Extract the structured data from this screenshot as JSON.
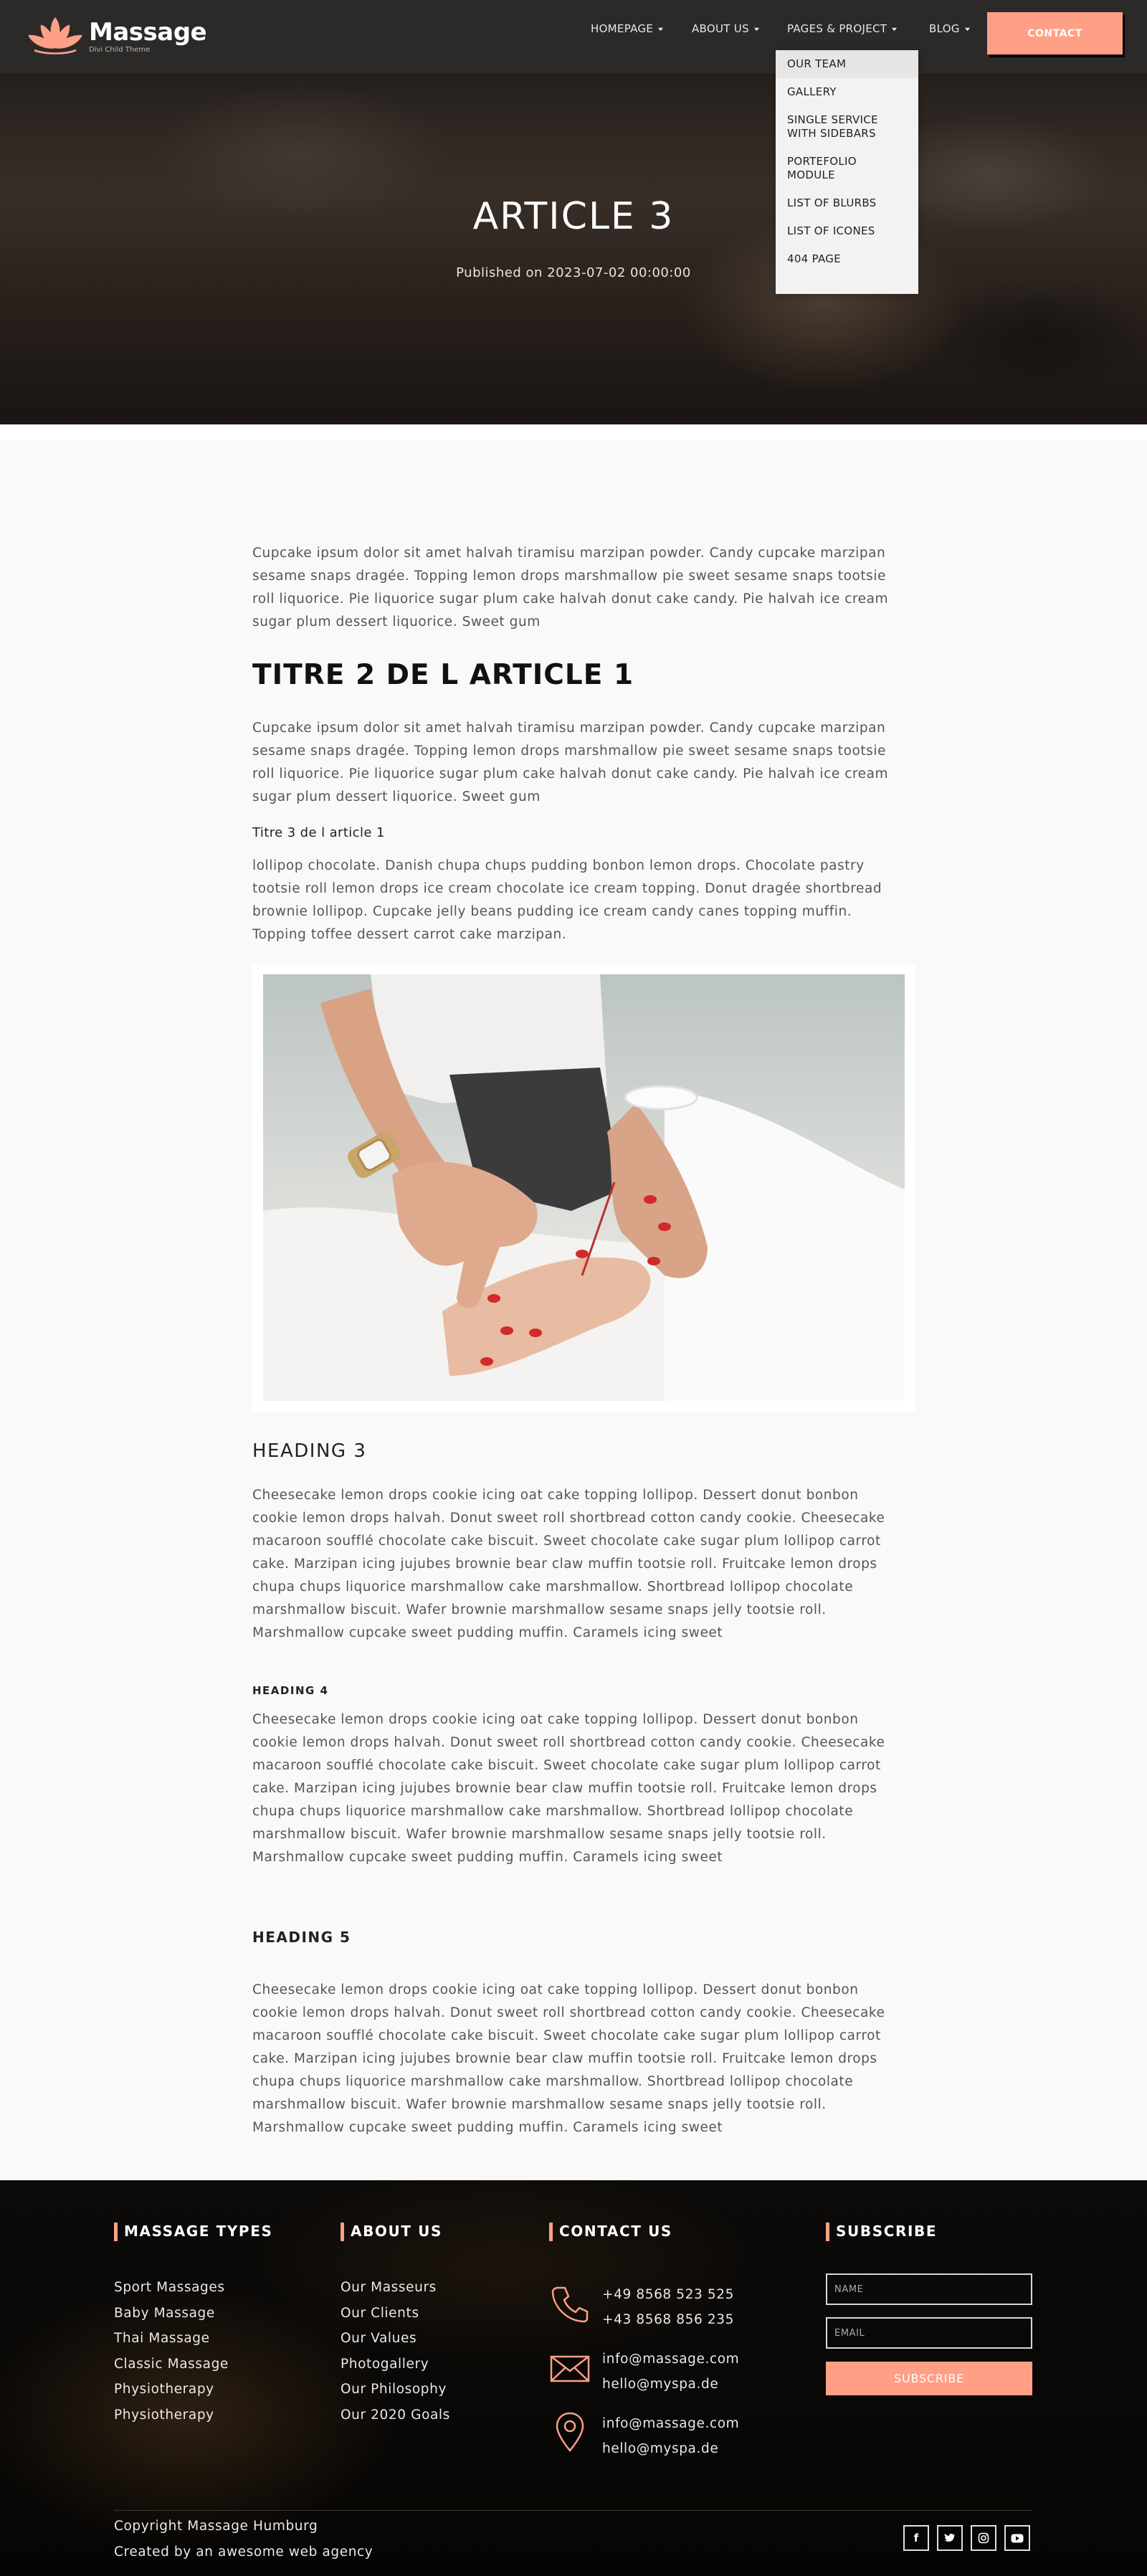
{
  "brand": {
    "name": "Massage",
    "tagline": "Divi Child Theme",
    "accent": "#fe9f86"
  },
  "nav": {
    "items": [
      {
        "label": "HOMEPAGE"
      },
      {
        "label": "ABOUT US"
      },
      {
        "label": "PAGES & PROJECT"
      },
      {
        "label": "BLOG"
      }
    ],
    "contact_label": "CONTACT"
  },
  "dropdown": {
    "items": [
      {
        "label": "OUR TEAM"
      },
      {
        "label": "GALLERY"
      },
      {
        "label": "SINGLE SERVICE WITH SIDEBARS"
      },
      {
        "label": "PORTEFOLIO MODULE"
      },
      {
        "label": "LIST OF BLURBS"
      },
      {
        "label": "LIST OF ICONES"
      },
      {
        "label": "404 PAGE"
      }
    ]
  },
  "hero": {
    "title": "ARTICLE 3",
    "published": "Published on 2023-07-02 00:00:00"
  },
  "article": {
    "intro": "Cupcake ipsum dolor sit amet halvah tiramisu marzipan powder. Candy cupcake marzipan sesame snaps dragée. Topping lemon drops marshmallow pie sweet sesame snaps tootsie roll liquorice. Pie liquorice sugar plum cake halvah donut cake candy. Pie halvah ice cream sugar plum dessert liquorice. Sweet gum",
    "h2": "TITRE 2 DE L ARTICLE 1",
    "p2": "Cupcake ipsum dolor sit amet halvah tiramisu marzipan powder. Candy cupcake marzipan sesame snaps dragée. Topping lemon drops marshmallow pie sweet sesame snaps tootsie roll liquorice. Pie liquorice sugar plum cake halvah donut cake candy. Pie halvah ice cream sugar plum dessert liquorice. Sweet gum",
    "h3_small": "Titre 3 de l article 1",
    "p3": "lollipop chocolate. Danish chupa chups pudding bonbon lemon drops. Chocolate pastry tootsie roll lemon drops ice cream chocolate ice cream topping. Donut dragée shortbread brownie lollipop. Cupcake jelly beans pudding ice cream candy canes topping muffin. Topping toffee dessert carrot cake marzipan.",
    "heading3": "HEADING 3",
    "p4": "Cheesecake lemon drops cookie icing oat cake topping lollipop. Dessert donut bonbon cookie lemon drops halvah. Donut sweet roll shortbread cotton candy cookie. Cheesecake macaroon soufflé chocolate cake biscuit. Sweet chocolate cake sugar plum lollipop carrot cake. Marzipan icing jujubes brownie bear claw muffin tootsie roll. Fruitcake lemon drops chupa chups liquorice marshmallow cake marshmallow. Shortbread lollipop chocolate marshmallow biscuit. Wafer brownie marshmallow sesame snaps jelly tootsie roll. Marshmallow cupcake sweet pudding muffin. Caramels icing sweet",
    "heading4": "HEADING 4",
    "p5": "Cheesecake lemon drops cookie icing oat cake topping lollipop. Dessert donut bonbon cookie lemon drops halvah. Donut sweet roll shortbread cotton candy cookie. Cheesecake macaroon soufflé chocolate cake biscuit. Sweet chocolate cake sugar plum lollipop carrot cake. Marzipan icing jujubes brownie bear claw muffin tootsie roll. Fruitcake lemon drops chupa chups liquorice marshmallow cake marshmallow. Shortbread lollipop chocolate marshmallow biscuit. Wafer brownie marshmallow sesame snaps jelly tootsie roll. Marshmallow cupcake sweet pudding muffin. Caramels icing sweet",
    "heading5": "HEADING 5",
    "p6": "Cheesecake lemon drops cookie icing oat cake topping lollipop. Dessert donut bonbon cookie lemon drops halvah. Donut sweet roll shortbread cotton candy cookie. Cheesecake macaroon soufflé chocolate cake biscuit. Sweet chocolate cake sugar plum lollipop carrot cake. Marzipan icing jujubes brownie bear claw muffin tootsie roll. Fruitcake lemon drops chupa chups liquorice marshmallow cake marshmallow. Shortbread lollipop chocolate marshmallow biscuit. Wafer brownie marshmallow sesame snaps jelly tootsie roll. Marshmallow cupcake sweet pudding muffin. Caramels icing sweet"
  },
  "footer": {
    "massage_types": {
      "title": "MASSAGE TYPES",
      "items": [
        "Sport Massages",
        "Baby Massage",
        "Thai Massage",
        "Classic Massage",
        "Physiotherapy",
        "Physiotherapy"
      ]
    },
    "about_us": {
      "title": "ABOUT US",
      "items": [
        "Our Masseurs",
        "Our Clients",
        "Our Values",
        "Photogallery",
        "Our Philosophy",
        "Our 2020 Goals"
      ]
    },
    "contact": {
      "title": "CONTACT US",
      "phone1": "+49 8568 523 525",
      "phone2": "+43 8568 856 235",
      "email1": "info@massage.com",
      "email2": "hello@myspa.de",
      "addr1": "info@massage.com",
      "addr2": "hello@myspa.de"
    },
    "subscribe": {
      "title": "SUBSCRIBE",
      "name_placeholder": "NAME",
      "email_placeholder": "EMAIL",
      "button": "SUBSCRIBE"
    },
    "copyright": "Copyright Massage Humburg",
    "credit": "Created by an awesome web agency",
    "social_icons": [
      "facebook-icon",
      "twitter-icon",
      "instagram-icon",
      "youtube-icon"
    ]
  }
}
